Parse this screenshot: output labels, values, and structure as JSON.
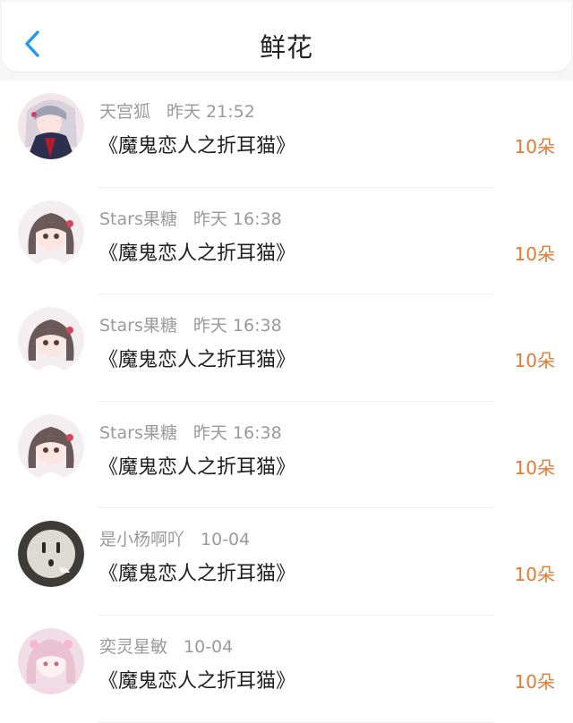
{
  "header": {
    "title": "鲜花",
    "back_icon": "chevron-left-icon",
    "accent": "#2196f3"
  },
  "colors": {
    "count": "#e27a32",
    "meta": "#9a9a9a"
  },
  "items": [
    {
      "user": "天宫狐",
      "time": "昨天 21:52",
      "book": "《魔鬼恋人之折耳猫》",
      "count": "10朵",
      "avatar": "fox"
    },
    {
      "user": "Stars果糖",
      "time": "昨天 16:38",
      "book": "《魔鬼恋人之折耳猫》",
      "count": "10朵",
      "avatar": "girl"
    },
    {
      "user": "Stars果糖",
      "time": "昨天 16:38",
      "book": "《魔鬼恋人之折耳猫》",
      "count": "10朵",
      "avatar": "girl"
    },
    {
      "user": "Stars果糖",
      "time": "昨天 16:38",
      "book": "《魔鬼恋人之折耳猫》",
      "count": "10朵",
      "avatar": "girl"
    },
    {
      "user": "是小杨啊吖",
      "time": "10-04",
      "book": "《魔鬼恋人之折耳猫》",
      "count": "10朵",
      "avatar": "socket"
    },
    {
      "user": "奕灵星敏",
      "time": "10-04",
      "book": "《魔鬼恋人之折耳猫》",
      "count": "10朵",
      "avatar": "pink"
    }
  ]
}
